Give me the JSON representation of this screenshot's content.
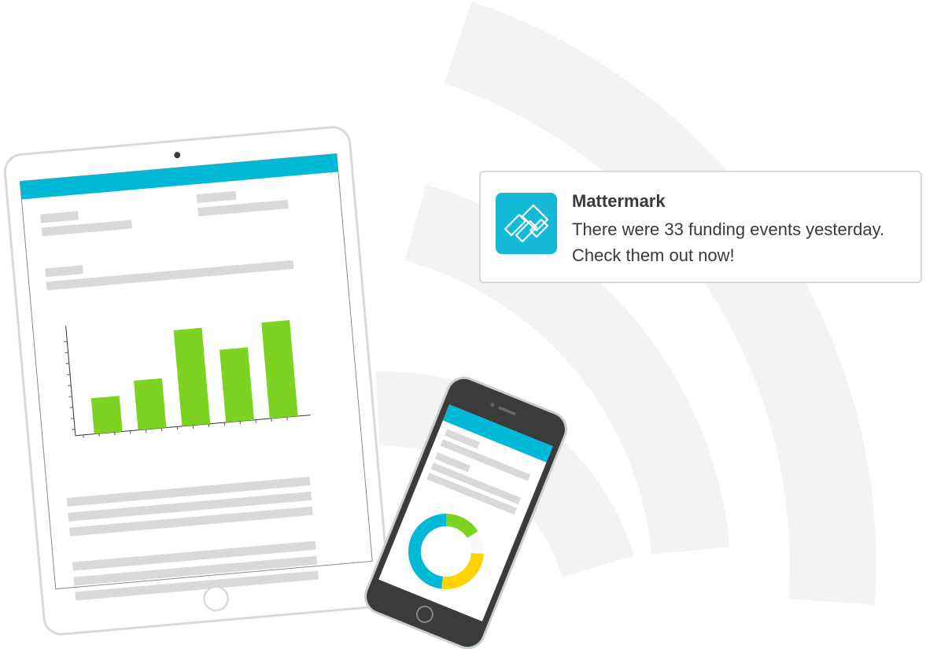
{
  "notification": {
    "app_name": "Mattermark",
    "message": "There were 33 funding events yesterday. Check them out now!",
    "icon": "mattermark-logo-icon",
    "icon_color": "#13b9d6"
  },
  "tablet": {
    "header_color": "#00b9d6",
    "chart_data": {
      "type": "bar",
      "categories": [
        "",
        "",
        "",
        "",
        ""
      ],
      "values": [
        2.6,
        3.6,
        7.0,
        5.3,
        7.0
      ],
      "bar_color": "#7dd321",
      "grid": false,
      "title": "",
      "xlabel": "",
      "ylabel": "",
      "ylim": [
        0,
        8
      ]
    }
  },
  "phone": {
    "header_color": "#00b9d6",
    "chart_data": {
      "type": "pie",
      "style": "donut",
      "slices": [
        {
          "value": 16,
          "color": "#7dd321"
        },
        {
          "value": 10,
          "color": "#fafafa"
        },
        {
          "value": 26,
          "color": "#fdd300"
        },
        {
          "value": 48,
          "color": "#00b9d6"
        }
      ]
    }
  },
  "colors": {
    "wifi_arcs": "#f3f3f3",
    "device_outline": "#d5dbda",
    "placeholder_lines": "#d9d9d9",
    "phone_body": "#3b3b3b"
  }
}
